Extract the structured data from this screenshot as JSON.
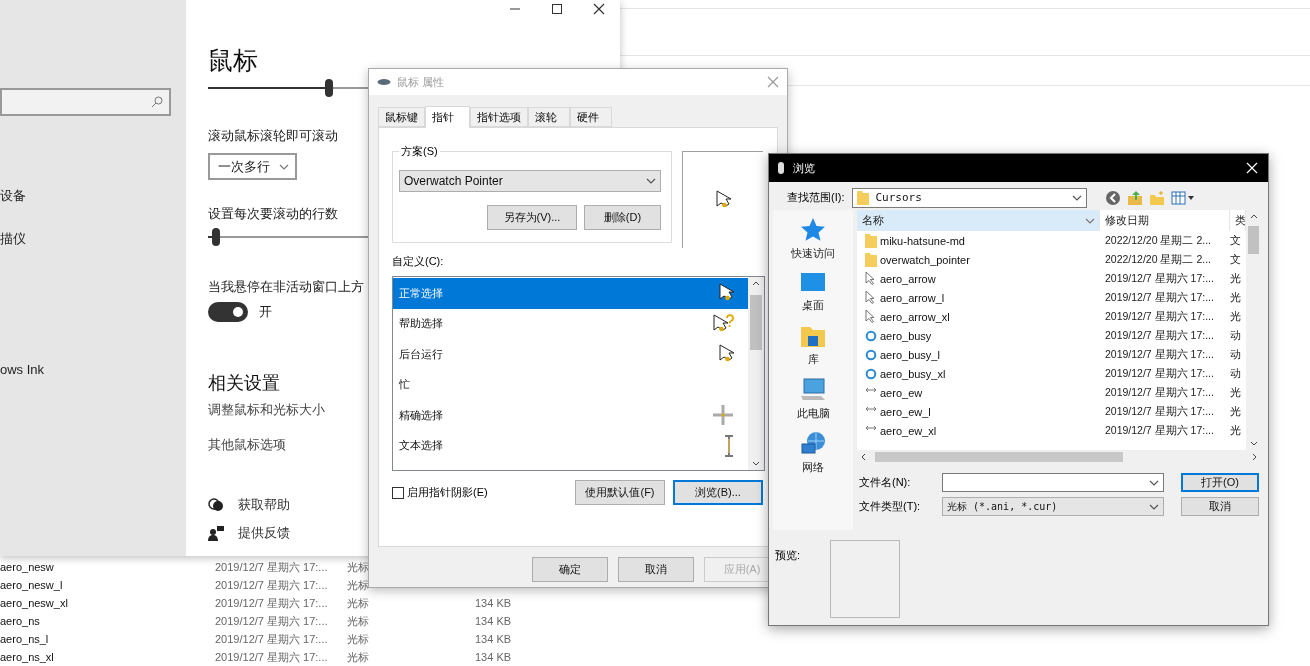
{
  "explorer": {
    "rows": [
      {
        "name": "aero_nesw",
        "date": "2019/12/7 星期六 17:...",
        "type": "光标"
      },
      {
        "name": "aero_nesw_l",
        "date": "2019/12/7 星期六 17:...",
        "type": "光标"
      },
      {
        "name": "aero_nesw_xl",
        "date": "2019/12/7 星期六 17:...",
        "type": "光标",
        "size": "134 KB"
      },
      {
        "name": "aero_ns",
        "date": "2019/12/7 星期六 17:...",
        "type": "光标",
        "size": "134 KB"
      },
      {
        "name": "aero_ns_l",
        "date": "2019/12/7 星期六 17:...",
        "type": "光标",
        "size": "134 KB"
      },
      {
        "name": "aero_ns_xl",
        "date": "2019/12/7 星期六 17:...",
        "type": "光标",
        "size": "134 KB"
      }
    ]
  },
  "settings": {
    "nav_items": [
      "设备",
      "描仪",
      "ows Ink"
    ],
    "title": "鼠标",
    "pointer_speed": {
      "level": 0.46
    },
    "wheel": {
      "label": "滚动鼠标滚轮即可滚动",
      "value": "一次多行"
    },
    "lines": {
      "label": "设置每次要滚动的行数",
      "level": 0.03
    },
    "inactive_scroll": {
      "label": "当我悬停在非活动窗口上方",
      "on": true,
      "state_label": "开"
    },
    "related": {
      "heading": "相关设置",
      "links": [
        "调整鼠标和光标大小",
        "其他鼠标选项"
      ]
    },
    "help_links": [
      {
        "kind": "help",
        "label": "获取帮助"
      },
      {
        "kind": "feedback",
        "label": "提供反馈"
      }
    ]
  },
  "mouse_properties": {
    "title": "鼠标 属性",
    "tabs": [
      {
        "label": "鼠标键",
        "selected": false
      },
      {
        "label": "指针",
        "selected": true
      },
      {
        "label": "指针选项",
        "selected": false
      },
      {
        "label": "滚轮",
        "selected": false
      },
      {
        "label": "硬件",
        "selected": false
      }
    ],
    "scheme": {
      "label": "方案(S)",
      "value": "Overwatch Pointer",
      "buttons": [
        "另存为(V)...",
        "删除(D)"
      ]
    },
    "customize_label": "自定义(C):",
    "cursors": [
      {
        "label": "正常选择",
        "kind": "arrow",
        "selected": true
      },
      {
        "label": "帮助选择",
        "kind": "help",
        "selected": false
      },
      {
        "label": "后台运行",
        "kind": "working",
        "selected": false
      },
      {
        "label": "忙",
        "kind": "none",
        "selected": false
      },
      {
        "label": "精确选择",
        "kind": "cross",
        "selected": false
      },
      {
        "label": "文本选择",
        "kind": "text",
        "selected": false
      }
    ],
    "shadow": {
      "label": "启用指针阴影(E)",
      "checked": false
    },
    "buttons": [
      "使用默认值(F)",
      "浏览(B)..."
    ],
    "footer": [
      {
        "label": "确定",
        "disabled": false
      },
      {
        "label": "取消",
        "disabled": false
      },
      {
        "label": "应用(A)",
        "disabled": true
      }
    ]
  },
  "browse": {
    "title": "浏览",
    "look_in": {
      "label": "查找范围(I):",
      "value": "Cursors"
    },
    "places": [
      {
        "label": "快速访问",
        "kind": "star"
      },
      {
        "label": "桌面",
        "kind": "desktop"
      },
      {
        "label": "库",
        "kind": "library"
      },
      {
        "label": "此电脑",
        "kind": "pc"
      },
      {
        "label": "网络",
        "kind": "network"
      }
    ],
    "columns": [
      {
        "label": "名称",
        "selected": true
      },
      {
        "label": "修改日期",
        "selected": false
      },
      {
        "label": "类",
        "selected": false
      }
    ],
    "files": [
      {
        "name": "miku-hatsune-md",
        "kind": "folder",
        "date": "2022/12/20 星期二 2...",
        "column_3": "文"
      },
      {
        "name": "overwatch_pointer",
        "kind": "folder",
        "date": "2022/12/20 星期二 2...",
        "column_3": "文"
      },
      {
        "name": "aero_arrow",
        "kind": "arrow",
        "date": "2019/12/7 星期六 17:...",
        "column_3": "光"
      },
      {
        "name": "aero_arrow_l",
        "kind": "arrow",
        "date": "2019/12/7 星期六 17:...",
        "column_3": "光"
      },
      {
        "name": "aero_arrow_xl",
        "kind": "arrow",
        "date": "2019/12/7 星期六 17:...",
        "column_3": "光"
      },
      {
        "name": "aero_busy",
        "kind": "busy",
        "date": "2019/12/7 星期六 17:...",
        "column_3": "动"
      },
      {
        "name": "aero_busy_l",
        "kind": "busy",
        "date": "2019/12/7 星期六 17:...",
        "column_3": "动"
      },
      {
        "name": "aero_busy_xl",
        "kind": "busy",
        "date": "2019/12/7 星期六 17:...",
        "column_3": "动"
      },
      {
        "name": "aero_ew",
        "kind": "ew",
        "date": "2019/12/7 星期六 17:...",
        "column_3": "光"
      },
      {
        "name": "aero_ew_l",
        "kind": "ew",
        "date": "2019/12/7 星期六 17:...",
        "column_3": "光"
      },
      {
        "name": "aero_ew_xl",
        "kind": "ew",
        "date": "2019/12/7 星期六 17:...",
        "column_3": "光"
      }
    ],
    "file_name": {
      "label": "文件名(N):"
    },
    "file_type": {
      "label": "文件类型(T):",
      "value": "光标 (*.ani, *.cur)"
    },
    "buttons": [
      "打开(O)",
      "取消"
    ],
    "preview_label": "预览:"
  }
}
